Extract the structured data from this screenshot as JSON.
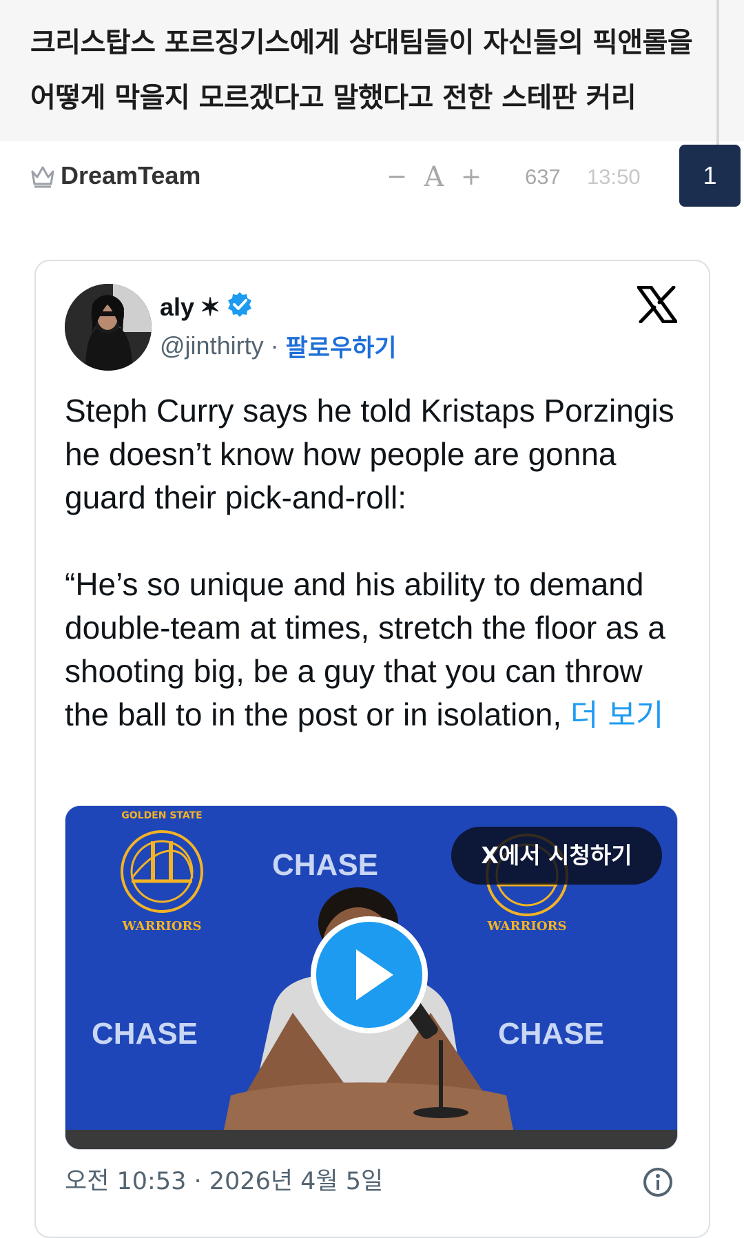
{
  "post": {
    "title": "크리스탑스 포르징기스에게 상대팀들이 자신들의 픽앤롤을 어떻게 막을지 모르겠다고 말했다고 전한 스테판 커리"
  },
  "meta": {
    "site_name": "DreamTeam",
    "site_icon": "crown-icon",
    "font_decrease": "−",
    "font_label": "A",
    "font_increase": "+",
    "views": "637",
    "time": "13:50",
    "comment_count": "1"
  },
  "tweet": {
    "author_name": "aly",
    "name_symbol": "✶",
    "verified_icon": "verified-badge-icon",
    "handle": "@jinthirty",
    "separator": "·",
    "follow_label": "팔로우하기",
    "platform_icon": "x-logo-icon",
    "body": "Steph Curry says he told Kristaps Porzingis he doesn’t know how people are gonna guard their pick-and-roll:\n\n“He’s so unique and his ability to demand double-team at times, stretch the floor as a shooting big, be a guy that you can throw the ball to in the post or in isolation, ",
    "more_label": "더 보기",
    "video": {
      "watch_label": "X에서 시청하기",
      "play_icon": "play-icon",
      "sponsor_text": "CHASE",
      "team_text_top": "GOLDEN STATE",
      "team_text_bottom": "WARRIORS"
    },
    "timestamp": "오전 10:53 · 2026년 4월 5일",
    "info_icon": "info-icon"
  },
  "colors": {
    "badge_bg": "#1c2e4f",
    "link_blue": "#1d9bf0",
    "follow_blue": "#1d6fd8",
    "video_bg": "#1e46b8",
    "warriors_gold": "#f4b324"
  }
}
